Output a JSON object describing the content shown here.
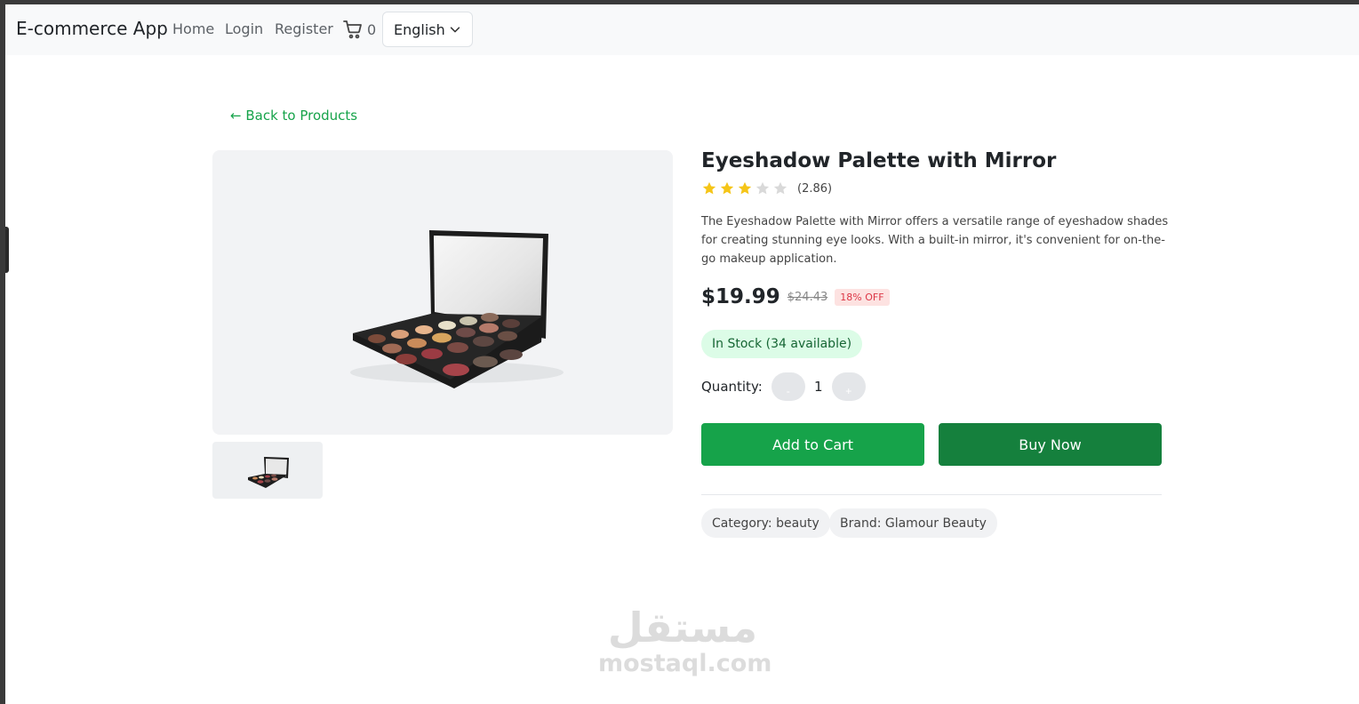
{
  "navbar": {
    "brand": "E-commerce App",
    "links": [
      "Home",
      "Login",
      "Register"
    ],
    "cart_count": "0",
    "language": "English"
  },
  "product": {
    "back_label": "← Back to Products",
    "title": "Eyeshadow Palette with Mirror",
    "rating_text": "(2.86)",
    "rating_value": 2.86,
    "stars_filled": 3,
    "stars_total": 5,
    "description": "The Eyeshadow Palette with Mirror offers a versatile range of eyeshadow shades for creating stunning eye looks. With a built-in mirror, it's convenient for on-the-go makeup application.",
    "price": "$19.99",
    "old_price": "$24.43",
    "discount": "18% OFF",
    "stock": "In Stock (34 available)",
    "quantity_label": "Quantity:",
    "quantity": "1",
    "minus_label": "-",
    "plus_label": "+",
    "add_to_cart": "Add to Cart",
    "buy_now": "Buy Now",
    "category": "Category: beauty",
    "brand": "Brand: Glamour Beauty"
  },
  "watermark": {
    "arabic": "مستقل",
    "latin": "mostaql.com"
  },
  "colors": {
    "accent": "#16a34a",
    "accent_dark": "#15803d",
    "star": "#f5c518",
    "star_empty": "#d9d9d9"
  }
}
